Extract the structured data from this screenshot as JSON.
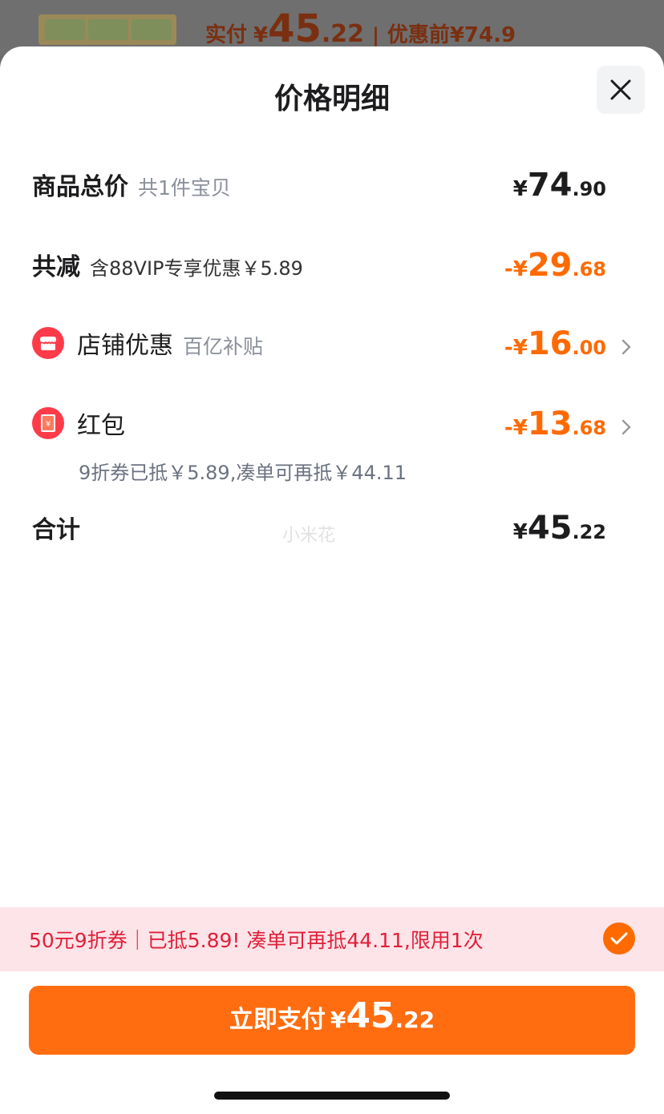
{
  "top": {
    "paid_label": "实付",
    "currency": "¥",
    "paid_int": "45",
    "paid_dec": ".22",
    "separator": "|",
    "before_discount": "优惠前¥74.9"
  },
  "sheet": {
    "title": "价格明细",
    "close_icon": "close-icon"
  },
  "rows": {
    "total": {
      "label": "商品总价",
      "sub": "共1件宝贝",
      "sym": "¥",
      "int": "74",
      "dec": ".90"
    },
    "reduce": {
      "label": "共减",
      "sub": "含88VIP专享优惠￥5.89",
      "sym": "-¥",
      "int": "29",
      "dec": ".68"
    },
    "shop": {
      "label": "店铺优惠",
      "sub": "百亿补贴",
      "sym": "-¥",
      "int": "16",
      "dec": ".00",
      "icon": "shop-icon"
    },
    "hongbao": {
      "label": "红包",
      "detail": "9折券已抵￥5.89,凑单可再抵￥44.11",
      "sym": "-¥",
      "int": "13",
      "dec": ".68",
      "icon": "red-envelope-icon"
    },
    "sum": {
      "label": "合计",
      "sym": "¥",
      "int": "45",
      "dec": ".22"
    }
  },
  "watermark": "小米花",
  "promo": {
    "text": "50元9折券｜已抵5.89! 凑单可再抵44.11,限用1次",
    "icon": "check-icon"
  },
  "pay": {
    "label": "立即支付",
    "sym": "¥",
    "int": "45",
    "dec": ".22"
  },
  "colors": {
    "accent": "#ff6a00",
    "danger": "#e0203a",
    "promo_bg": "#fde4e8"
  }
}
